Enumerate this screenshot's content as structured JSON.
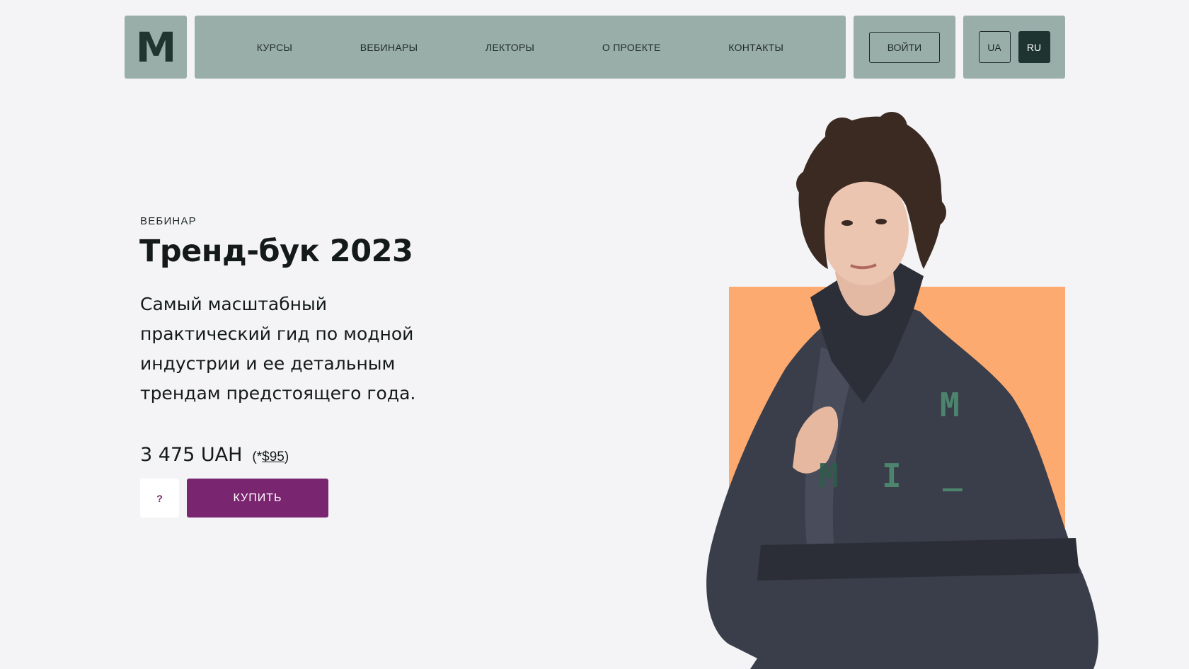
{
  "header": {
    "logo_text": "M",
    "nav": [
      "КУРСЫ",
      "ВЕБИНАРЫ",
      "ЛЕКТОРЫ",
      "О ПРОЕКТЕ",
      "КОНТАКТЫ"
    ],
    "login_label": "ВОЙТИ",
    "languages": [
      "UA",
      "RU"
    ],
    "active_language": "RU"
  },
  "hero": {
    "eyebrow": "ВЕБИНАР",
    "title": "Тренд-бук 2023",
    "description": "Самый масштабный практический гид по модной индустрии и ее детальным трендам предстоящего года.",
    "price": "3 475 UAH",
    "price_usd_prefix": "(*",
    "price_usd": "$95",
    "price_usd_suffix": ")",
    "help_label": "?",
    "buy_label": "КУПИТЬ"
  },
  "art": {
    "letters": [
      "M",
      "M",
      "I",
      "_"
    ]
  },
  "colors": {
    "header_bg": "#99aea9",
    "accent_purple": "#7a2570",
    "dark_green": "#1e3430",
    "orange": "#fcaa6f",
    "page_bg": "#f4f4f6"
  }
}
